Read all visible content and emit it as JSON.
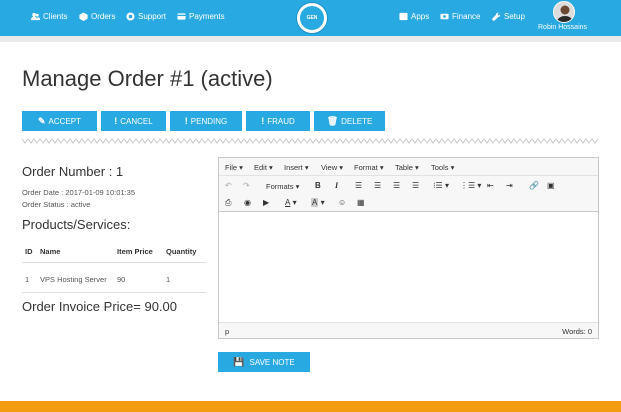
{
  "topbar": {
    "nav_left": [
      {
        "label": "Clients",
        "icon": "users-icon"
      },
      {
        "label": "Orders",
        "icon": "cube-icon"
      },
      {
        "label": "Support",
        "icon": "lifebuoy-icon"
      },
      {
        "label": "Payments",
        "icon": "credit-card-icon"
      }
    ],
    "nav_right": [
      {
        "label": "Apps",
        "icon": "grid-icon"
      },
      {
        "label": "Finance",
        "icon": "money-icon"
      },
      {
        "label": "Setup",
        "icon": "wrench-icon"
      }
    ],
    "user_name": "Robin Hossains",
    "logo_text": "GEN"
  },
  "page": {
    "title": "Manage Order #1 (active)"
  },
  "actions": {
    "accept": "ACCEPT",
    "cancel": "CANCEL",
    "pending": "PENDING",
    "fraud": "FRAUD",
    "delete": "DELETE"
  },
  "order": {
    "number_label": "Order Number : 1",
    "date_label": "Order Date : 2017-01-09 10:01:35",
    "status_label": "Order Status : active"
  },
  "products": {
    "heading": "Products/Services:",
    "columns": [
      "ID",
      "Name",
      "Item Price",
      "Quantity"
    ],
    "rows": [
      {
        "id": "1",
        "name": "VPS Hosting Server",
        "price": "90",
        "qty": "1"
      }
    ]
  },
  "invoice": {
    "label": "Order Invoice Price= 90.00"
  },
  "editor": {
    "menus": [
      "File",
      "Edit",
      "Insert",
      "View",
      "Format",
      "Table",
      "Tools"
    ],
    "formats_label": "Formats",
    "bold": "B",
    "italic": "I",
    "font_color": "A",
    "bg_color": "A",
    "path": "p",
    "word_count": "Words: 0"
  },
  "save_note": "SAVE NOTE",
  "colors": {
    "accent": "#29a9e1",
    "footer": "#f39c12"
  }
}
